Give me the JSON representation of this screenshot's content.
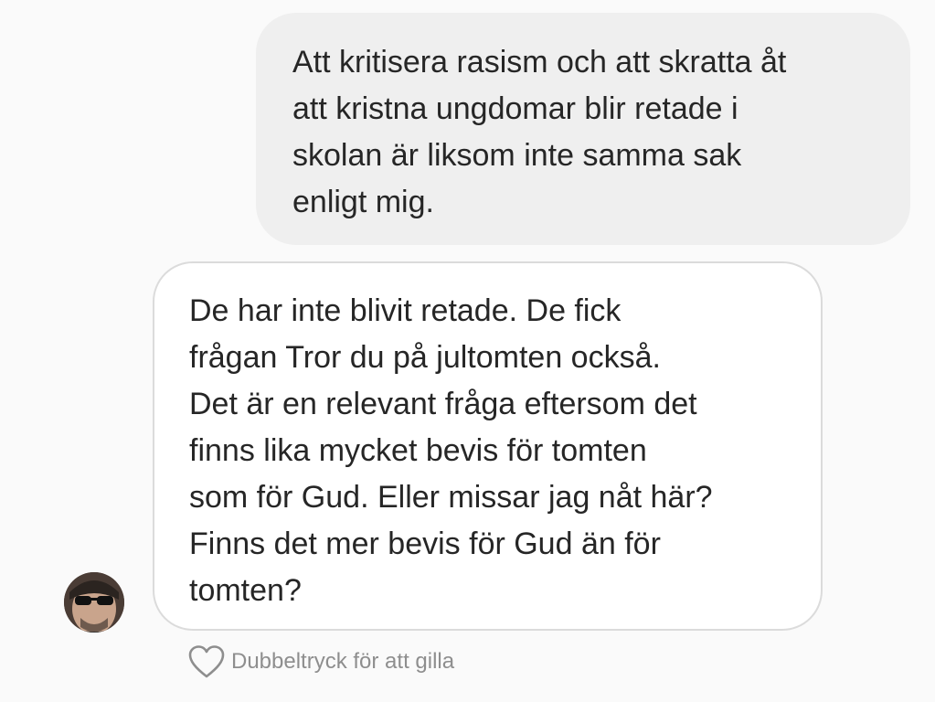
{
  "conversation": {
    "outgoing_message": "Att kritisera rasism och att skratta åt\natt kristna ungdomar blir retade i\nskolan är liksom inte samma sak\nenligt mig.",
    "incoming_message": "De har inte blivit retade. De fick\nfrågan Tror du på jultomten också.\nDet är en relevant fråga eftersom det\nfinns lika mycket bevis för tomten\nsom för Gud. Eller missar jag nåt här?\nFinns det mer bevis för Gud än för\ntomten?",
    "like_hint": "Dubbeltryck för att gilla"
  },
  "icons": {
    "like": "heart-icon",
    "avatar": "user-avatar"
  },
  "colors": {
    "background": "#fafafa",
    "outgoing_bubble": "#efefef",
    "incoming_bubble": "#ffffff",
    "incoming_border": "#dbdbdb",
    "text": "#262626",
    "hint_text": "#8e8e8e"
  }
}
